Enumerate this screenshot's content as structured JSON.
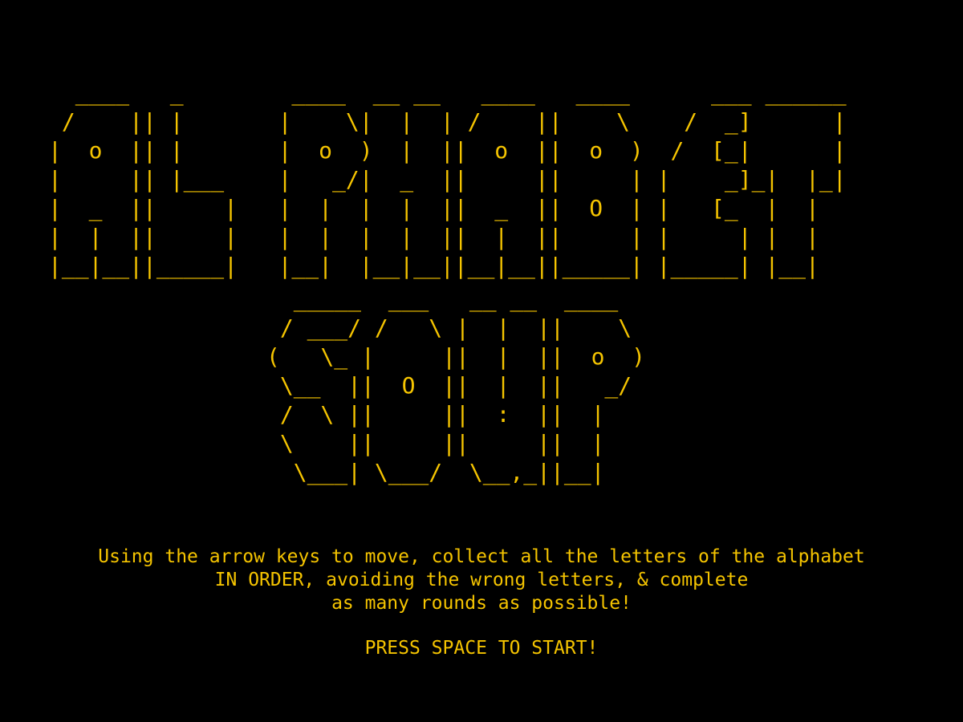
{
  "game": {
    "title_word1_ascii": [
      "  ____   _        ____  __ __   ____   ____      ___ ______",
      " /    || |       |    \\|  |  | /    ||    \\    /  _]      |",
      "|  o  || |       |  o  )  |  ||  o  ||  o  )  /  [_|      |",
      "|     || |___    |   _/|  _  ||     ||     | |    _]_|  |_|",
      "|  _  ||     |   |  |  |  |  ||  _  ||  O  | |   [_  |  |",
      "|  |  ||     |   |  |  |  |  ||  |  ||     | |     | |  |",
      "|__|__||_____|   |__|  |__|__||__|__||_____| |_____| |__|"
    ],
    "title_word2_ascii": [
      "  _____  ___   __ __  ____",
      " / ___/ /   \\ |  |  ||    \\",
      "(   \\_ |     ||  |  ||  o  )",
      " \\__  ||  O  ||  |  ||   _/",
      " /  \\ ||     ||  :  ||  |",
      " \\    ||     ||     ||  |",
      "  \\___| \\___/  \\__,_||__|"
    ],
    "instructions": [
      "Using the arrow keys to move, collect all the letters of the alphabet",
      "IN ORDER, avoiding the wrong letters, & complete",
      "as many rounds as possible!"
    ],
    "start_prompt": "PRESS SPACE TO START!",
    "text_color": "#f5c400",
    "background_color": "#000000"
  }
}
